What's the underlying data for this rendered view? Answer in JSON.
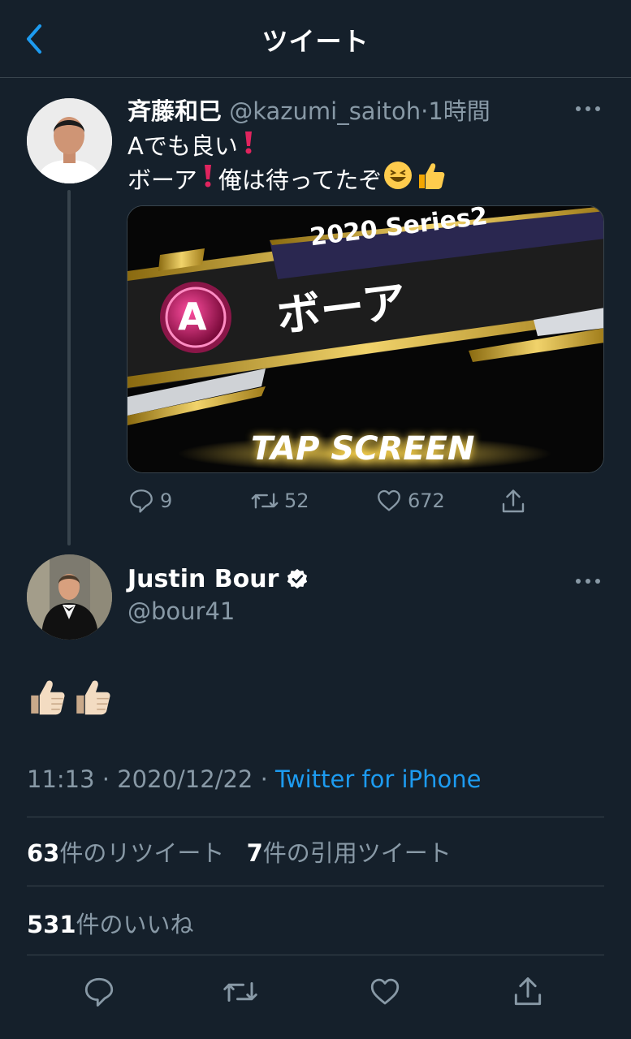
{
  "header": {
    "title": "ツイート",
    "back_icon": "chevron-left-icon"
  },
  "parent_tweet": {
    "author_name": "斉藤和巳",
    "handle": "@kazumi_saitoh",
    "time": "1時間",
    "text_line1": "Aでも良い",
    "text_line2a": "ボーア",
    "text_line2b": "俺は待ってたぞ",
    "media": {
      "series_label": "2020 Series2",
      "rank_letter": "A",
      "player_name": "ボーア",
      "tap_label": "TAP SCREEN"
    },
    "actions": {
      "replies": "9",
      "retweets": "52",
      "likes": "672"
    }
  },
  "main_tweet": {
    "author_name": "Justin Bour",
    "handle": "@bour41",
    "verified": true,
    "time": "11:13",
    "date": "2020/12/22",
    "source": "Twitter for iPhone",
    "retweet_count": "63",
    "retweet_label": "件のリツイート",
    "quote_count": "7",
    "quote_label": "件の引用ツイート",
    "like_count": "531",
    "like_label": "件のいいね"
  },
  "colors": {
    "background": "#15202b",
    "divider": "#38444d",
    "secondary_text": "#8899a6",
    "accent": "#1d9bf0",
    "verified_badge": "#ffffff"
  }
}
